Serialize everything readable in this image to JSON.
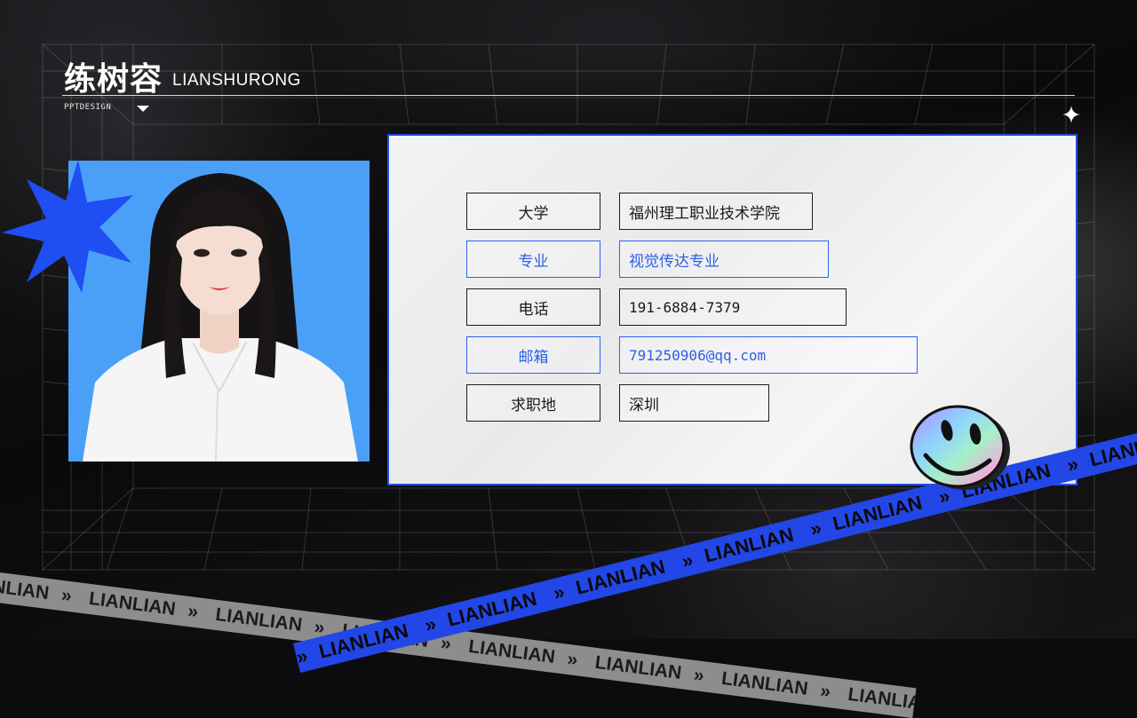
{
  "header": {
    "name_cn": "练树容",
    "name_en": "LIANSHURONG",
    "tag": "PPTDESIGN"
  },
  "photo": {
    "background_color": "#4aa0f6"
  },
  "info": {
    "rows": [
      {
        "label": "大学",
        "value": "福州理工职业技术学院",
        "accent": false
      },
      {
        "label": "专业",
        "value": "视觉传达专业",
        "accent": true
      },
      {
        "label": "电话",
        "value": "191-6884-7379",
        "accent": false
      },
      {
        "label": "邮箱",
        "value": "791250906@qq.com",
        "accent": true
      },
      {
        "label": "求职地",
        "value": "深圳",
        "accent": false
      }
    ]
  },
  "tapes": {
    "grey": {
      "text": "LIANLIAN",
      "separator": "»",
      "color": "#8d8d8d"
    },
    "blue": {
      "text": "LIANLIAN",
      "separator": "»",
      "color": "#2347e6"
    }
  },
  "colors": {
    "accent_blue": "#2d63f0",
    "background": "#0c0c0e",
    "card": "#efefef"
  },
  "icons": [
    "sparkle-icon",
    "blue-star-shape",
    "smiley-badge",
    "dropdown-triangle-icon"
  ]
}
